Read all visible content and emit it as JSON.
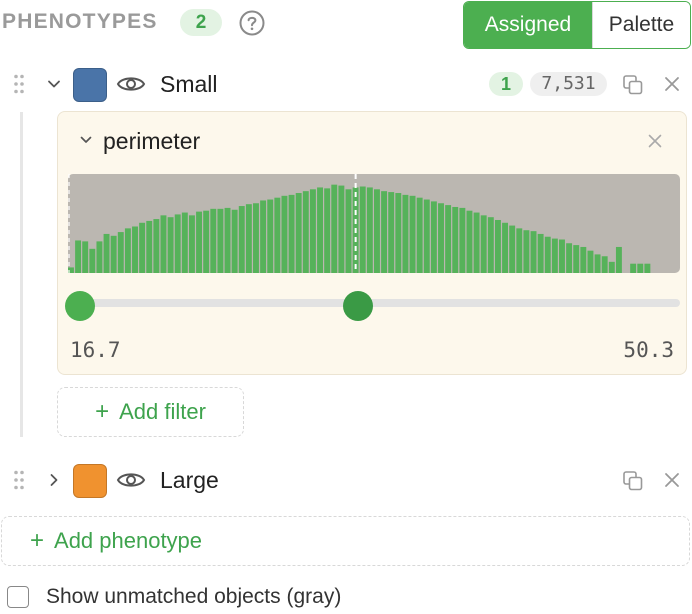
{
  "header": {
    "title": "PHENOTYPES",
    "count": "2",
    "toggle": {
      "assigned": "Assigned",
      "palette": "Palette"
    }
  },
  "colors": {
    "accent": "#4caf50",
    "small_swatch": "#4a74a8",
    "large_swatch": "#f0922f"
  },
  "phenotypes": [
    {
      "name": "Small",
      "expanded": true,
      "filter_count": "1",
      "object_count": "7,531",
      "filters": [
        {
          "name": "perimeter",
          "range_min": "16.7",
          "range_max": "50.3",
          "threshold_fraction": 0.47,
          "histogram": [
            0.06,
            0.35,
            0.34,
            0.26,
            0.34,
            0.42,
            0.4,
            0.44,
            0.48,
            0.5,
            0.54,
            0.56,
            0.58,
            0.62,
            0.6,
            0.63,
            0.65,
            0.62,
            0.66,
            0.67,
            0.69,
            0.69,
            0.7,
            0.68,
            0.72,
            0.74,
            0.75,
            0.78,
            0.79,
            0.81,
            0.83,
            0.84,
            0.86,
            0.88,
            0.9,
            0.92,
            0.91,
            0.95,
            0.94,
            0.9,
            0.92,
            0.93,
            0.92,
            0.9,
            0.88,
            0.87,
            0.86,
            0.84,
            0.83,
            0.81,
            0.79,
            0.77,
            0.75,
            0.73,
            0.71,
            0.7,
            0.67,
            0.65,
            0.62,
            0.6,
            0.57,
            0.54,
            0.51,
            0.48,
            0.46,
            0.45,
            0.42,
            0.39,
            0.37,
            0.36,
            0.32,
            0.3,
            0.28,
            0.24,
            0.2,
            0.18,
            0.12,
            0.28,
            0.0,
            0.1,
            0.1,
            0.1,
            0.0,
            0.0,
            0.0,
            0.0
          ]
        }
      ],
      "add_filter": "Add filter"
    },
    {
      "name": "Large",
      "expanded": false
    }
  ],
  "add_phenotype": "Add phenotype",
  "show_unmatched": {
    "label": "Show unmatched objects (gray)",
    "checked": false
  }
}
